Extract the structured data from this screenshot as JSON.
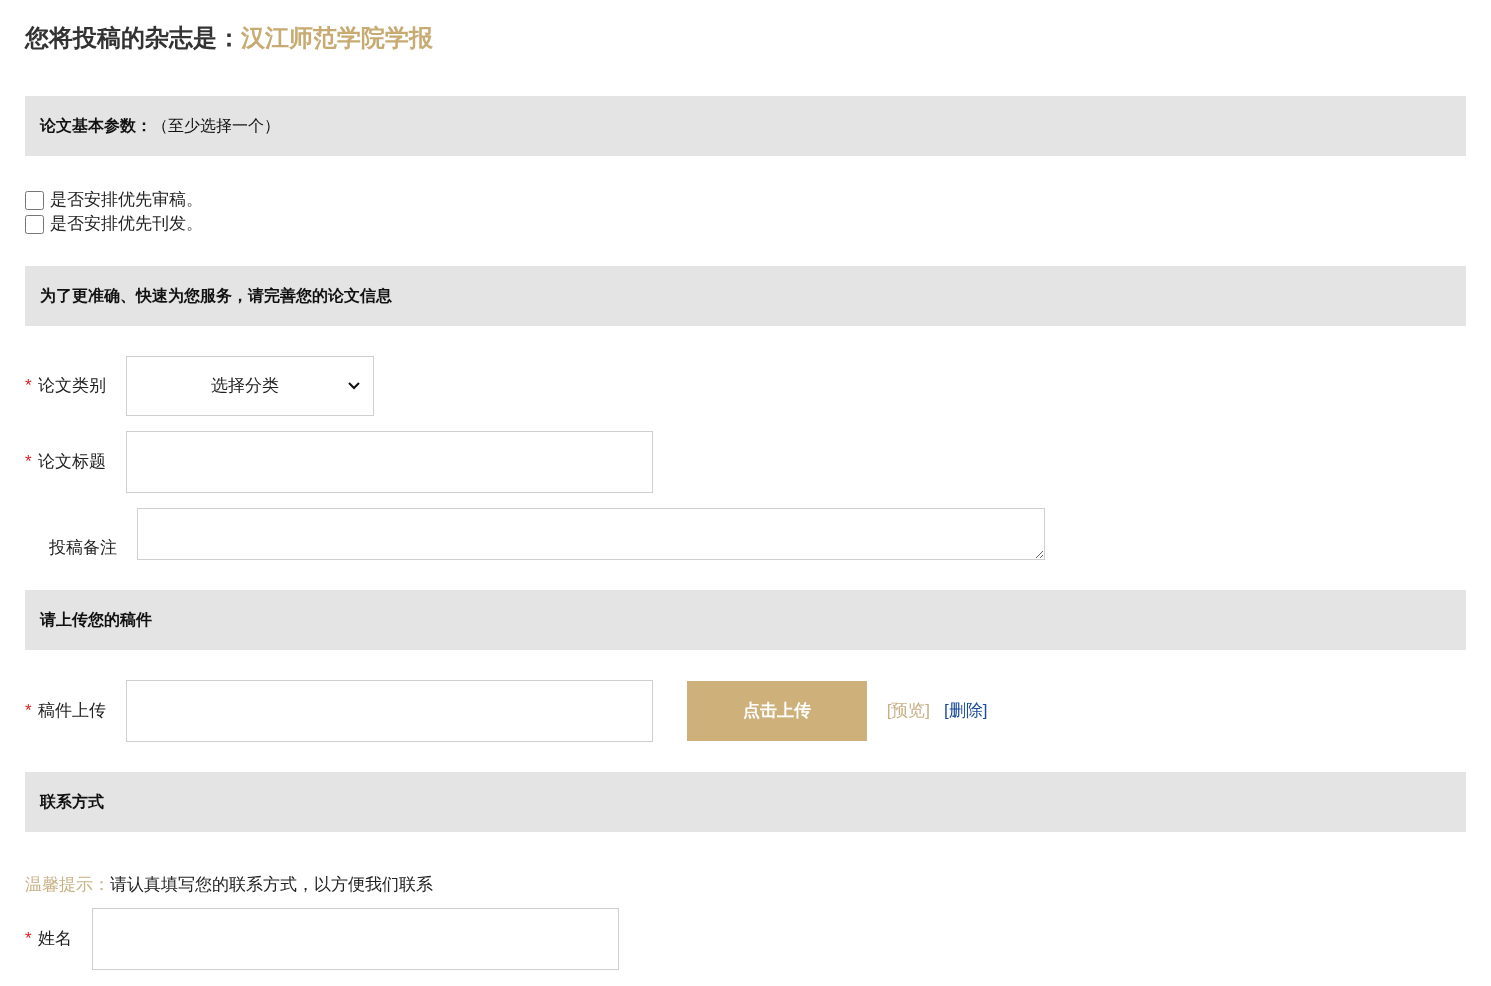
{
  "journal": {
    "prefix": "您将投稿的杂志是：",
    "name": "汉江师范学院学报"
  },
  "sections": [
    {
      "title": "**论文基本参数：**（至少选择一个）",
      "options": [
        {
          "label": "是否安排优先审稿。",
          "checked": false
        },
        {
          "label": "是否安排优先刊发。",
          "checked": false
        }
      ]
    },
    {
      "title": "为了更准确、快速为您服务，请完善您的论文信息",
      "fields": [
        {
          "kind": "select",
          "required_mark": "*",
          "label": "论文类别",
          "value": "选择分类"
        },
        {
          "kind": "input",
          "required_mark": "*",
          "label": "论文标题"
        },
        {
          "kind": "textarea",
          "label": "投稿备注"
        }
      ]
    },
    {
      "title": "请上传您的稿件",
      "fields": [
        {
          "kind": "upload",
          "required_mark": "*",
          "label": "稿件上传",
          "button": "点击上传",
          "links": [
            {
              "text": "[预览]",
              "color": "#c8b084"
            },
            {
              "text": "[删除]",
              "color": "#1a4c9c"
            }
          ]
        }
      ]
    },
    {
      "title": "联系方式",
      "tip": {
        "label": "温馨提示：",
        "text": "请认真填写您的联系方式，以方便我们联系"
      },
      "fields": [
        {
          "kind": "input",
          "required_mark": "*",
          "label": "姓名"
        }
      ]
    }
  ]
}
